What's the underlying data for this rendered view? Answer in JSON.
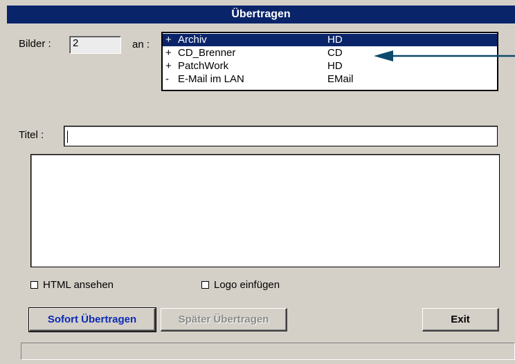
{
  "window": {
    "title": "Übertragen"
  },
  "images": {
    "label": "Bilder :",
    "value": "2"
  },
  "destination": {
    "label": "an :",
    "items": [
      {
        "marker": "+",
        "name": "Archiv",
        "type": "HD",
        "selected": true
      },
      {
        "marker": "+",
        "name": "CD_Brenner",
        "type": "CD",
        "selected": false
      },
      {
        "marker": "+",
        "name": "PatchWork",
        "type": "HD",
        "selected": false
      },
      {
        "marker": "-",
        "name": "E-Mail  im LAN",
        "type": "EMail",
        "selected": false
      }
    ]
  },
  "title_field": {
    "label": "Titel :",
    "value": ""
  },
  "description": {
    "value": ""
  },
  "checkboxes": {
    "html_view": {
      "label": "HTML  ansehen",
      "checked": false
    },
    "logo_insert": {
      "label": "Logo einfügen",
      "checked": false
    }
  },
  "buttons": {
    "send_now": "Sofort Übertragen",
    "send_later": "Später Übertragen",
    "exit": "Exit"
  },
  "status": {
    "text": ""
  },
  "colors": {
    "selection": "#0a246a",
    "annotation_arrow": "#0d4a6b",
    "default_button_text": "#0a2ab5"
  }
}
